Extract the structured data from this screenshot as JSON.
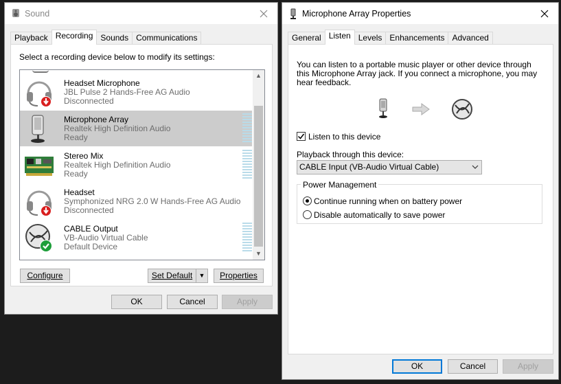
{
  "sound": {
    "title": "Sound",
    "tabs": [
      "Playback",
      "Recording",
      "Sounds",
      "Communications"
    ],
    "instruction": "Select a recording device below to modify its settings:",
    "devices": [
      {
        "name": "Headset Microphone",
        "driver": "JBL Pulse 2 Hands-Free AG Audio",
        "status": "Disconnected",
        "icon": "headset-disconnected-icon"
      },
      {
        "name": "Microphone Array",
        "driver": "Realtek High Definition Audio",
        "status": "Ready",
        "icon": "microphone-icon"
      },
      {
        "name": "Stereo Mix",
        "driver": "Realtek High Definition Audio",
        "status": "Ready",
        "icon": "sound-card-icon"
      },
      {
        "name": "Headset",
        "driver": "Symphonized NRG 2.0 W Hands-Free AG Audio",
        "status": "Disconnected",
        "icon": "headset-disconnected-icon"
      },
      {
        "name": "CABLE Output",
        "driver": "VB-Audio Virtual Cable",
        "status": "Default Device",
        "icon": "cable-default-icon"
      }
    ],
    "configure": "Configure",
    "set_default": "Set Default",
    "properties": "Properties",
    "ok": "OK",
    "cancel": "Cancel",
    "apply": "Apply"
  },
  "props": {
    "title": "Microphone Array Properties",
    "tabs": [
      "General",
      "Listen",
      "Levels",
      "Enhancements",
      "Advanced"
    ],
    "description": "You can listen to a portable music player or other device through this Microphone Array jack.  If you connect a microphone, you may hear feedback.",
    "listen_label": "Listen to this device",
    "listen_checked": true,
    "playback_label": "Playback through this device:",
    "playback_value": "CABLE Input (VB-Audio Virtual Cable)",
    "power_group": "Power Management",
    "radio1": "Continue running when on battery power",
    "radio2": "Disable automatically to save power",
    "ok": "OK",
    "cancel": "Cancel",
    "apply": "Apply"
  },
  "colors": {
    "selection": "#cccccc",
    "focus_blue": "#0078d7",
    "meter": "#b9dbe9"
  }
}
